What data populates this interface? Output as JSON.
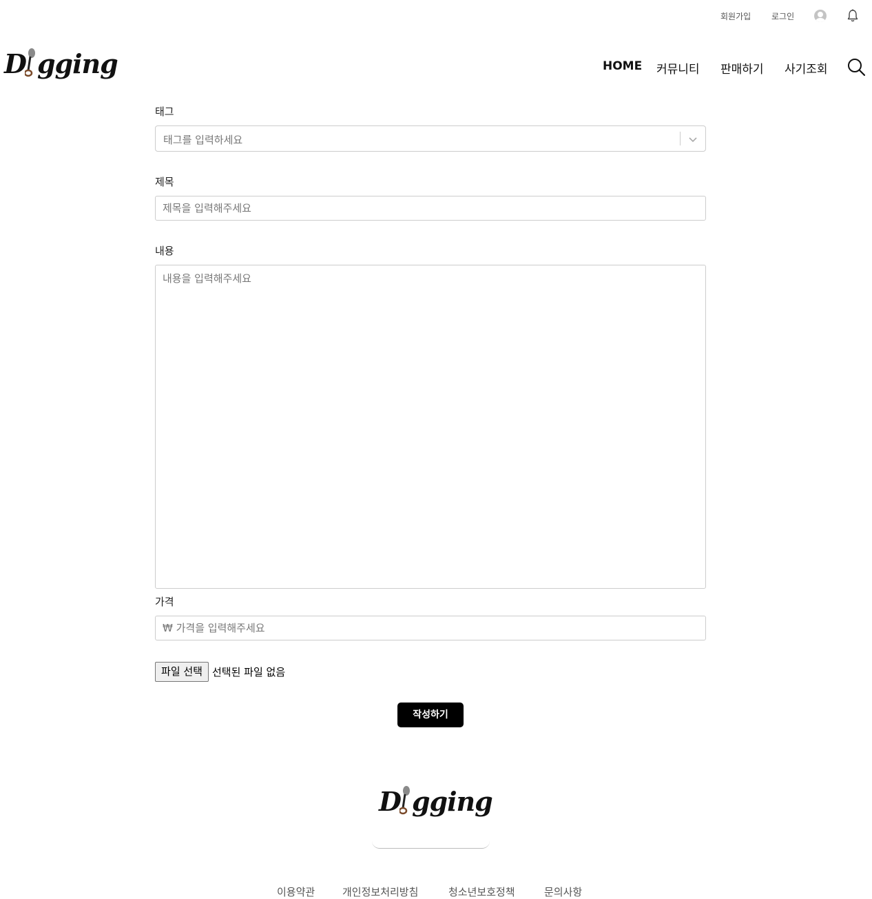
{
  "topbar": {
    "signup_label": "회원가입",
    "login_label": "로그인"
  },
  "logo": {
    "text_before": "D",
    "text_after": "gging"
  },
  "nav": {
    "items": [
      "HOME",
      "커뮤니티",
      "판매하기",
      "사기조회"
    ]
  },
  "form": {
    "tag": {
      "label": "태그",
      "placeholder": "태그를 입력하세요"
    },
    "title": {
      "label": "제목",
      "placeholder": "제목을 입력해주세요"
    },
    "content": {
      "label": "내용",
      "placeholder": "내용을 입력해주세요"
    },
    "price": {
      "label": "가격",
      "placeholder": "₩ 가격을 입력해주세요"
    },
    "file": {
      "button_label": "파일 선택",
      "status": "선택된 파일 없음"
    },
    "submit_label": "작성하기"
  },
  "footer": {
    "links": [
      "이용약관",
      "개인정보처리방침",
      "청소년보호정책",
      "문의사항"
    ]
  },
  "colors": {
    "accent": "#000000",
    "border": "#cccccc",
    "placeholder": "#777777"
  }
}
